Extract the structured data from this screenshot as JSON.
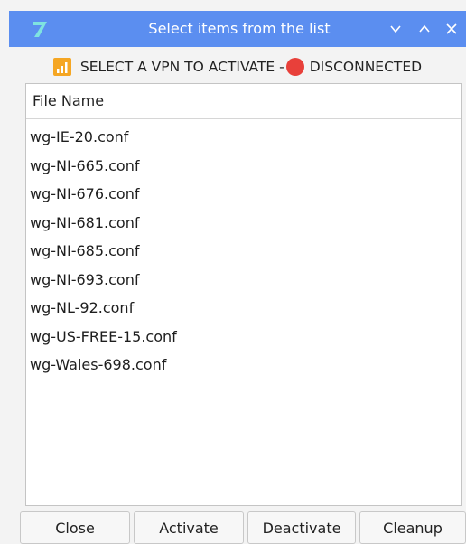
{
  "window": {
    "title": "Select items from the list",
    "icon": "app-logo-icon",
    "controls": [
      "minimize-icon",
      "maximize-icon",
      "close-icon"
    ],
    "titlebar_color": "#5b8ef0"
  },
  "status": {
    "prefix": "SELECT A VPN TO ACTIVATE -",
    "state": "DISCONNECTED",
    "state_color": "#e8403a",
    "signal_icon": "signal-bars-icon"
  },
  "list": {
    "header": "File Name",
    "items": [
      "wg-IE-20.conf",
      "wg-NI-665.conf",
      "wg-NI-676.conf",
      "wg-NI-681.conf",
      "wg-NI-685.conf",
      "wg-NI-693.conf",
      "wg-NL-92.conf",
      "wg-US-FREE-15.conf",
      "wg-Wales-698.conf"
    ]
  },
  "buttons": {
    "close": "Close",
    "activate": "Activate",
    "deactivate": "Deactivate",
    "cleanup": "Cleanup"
  }
}
